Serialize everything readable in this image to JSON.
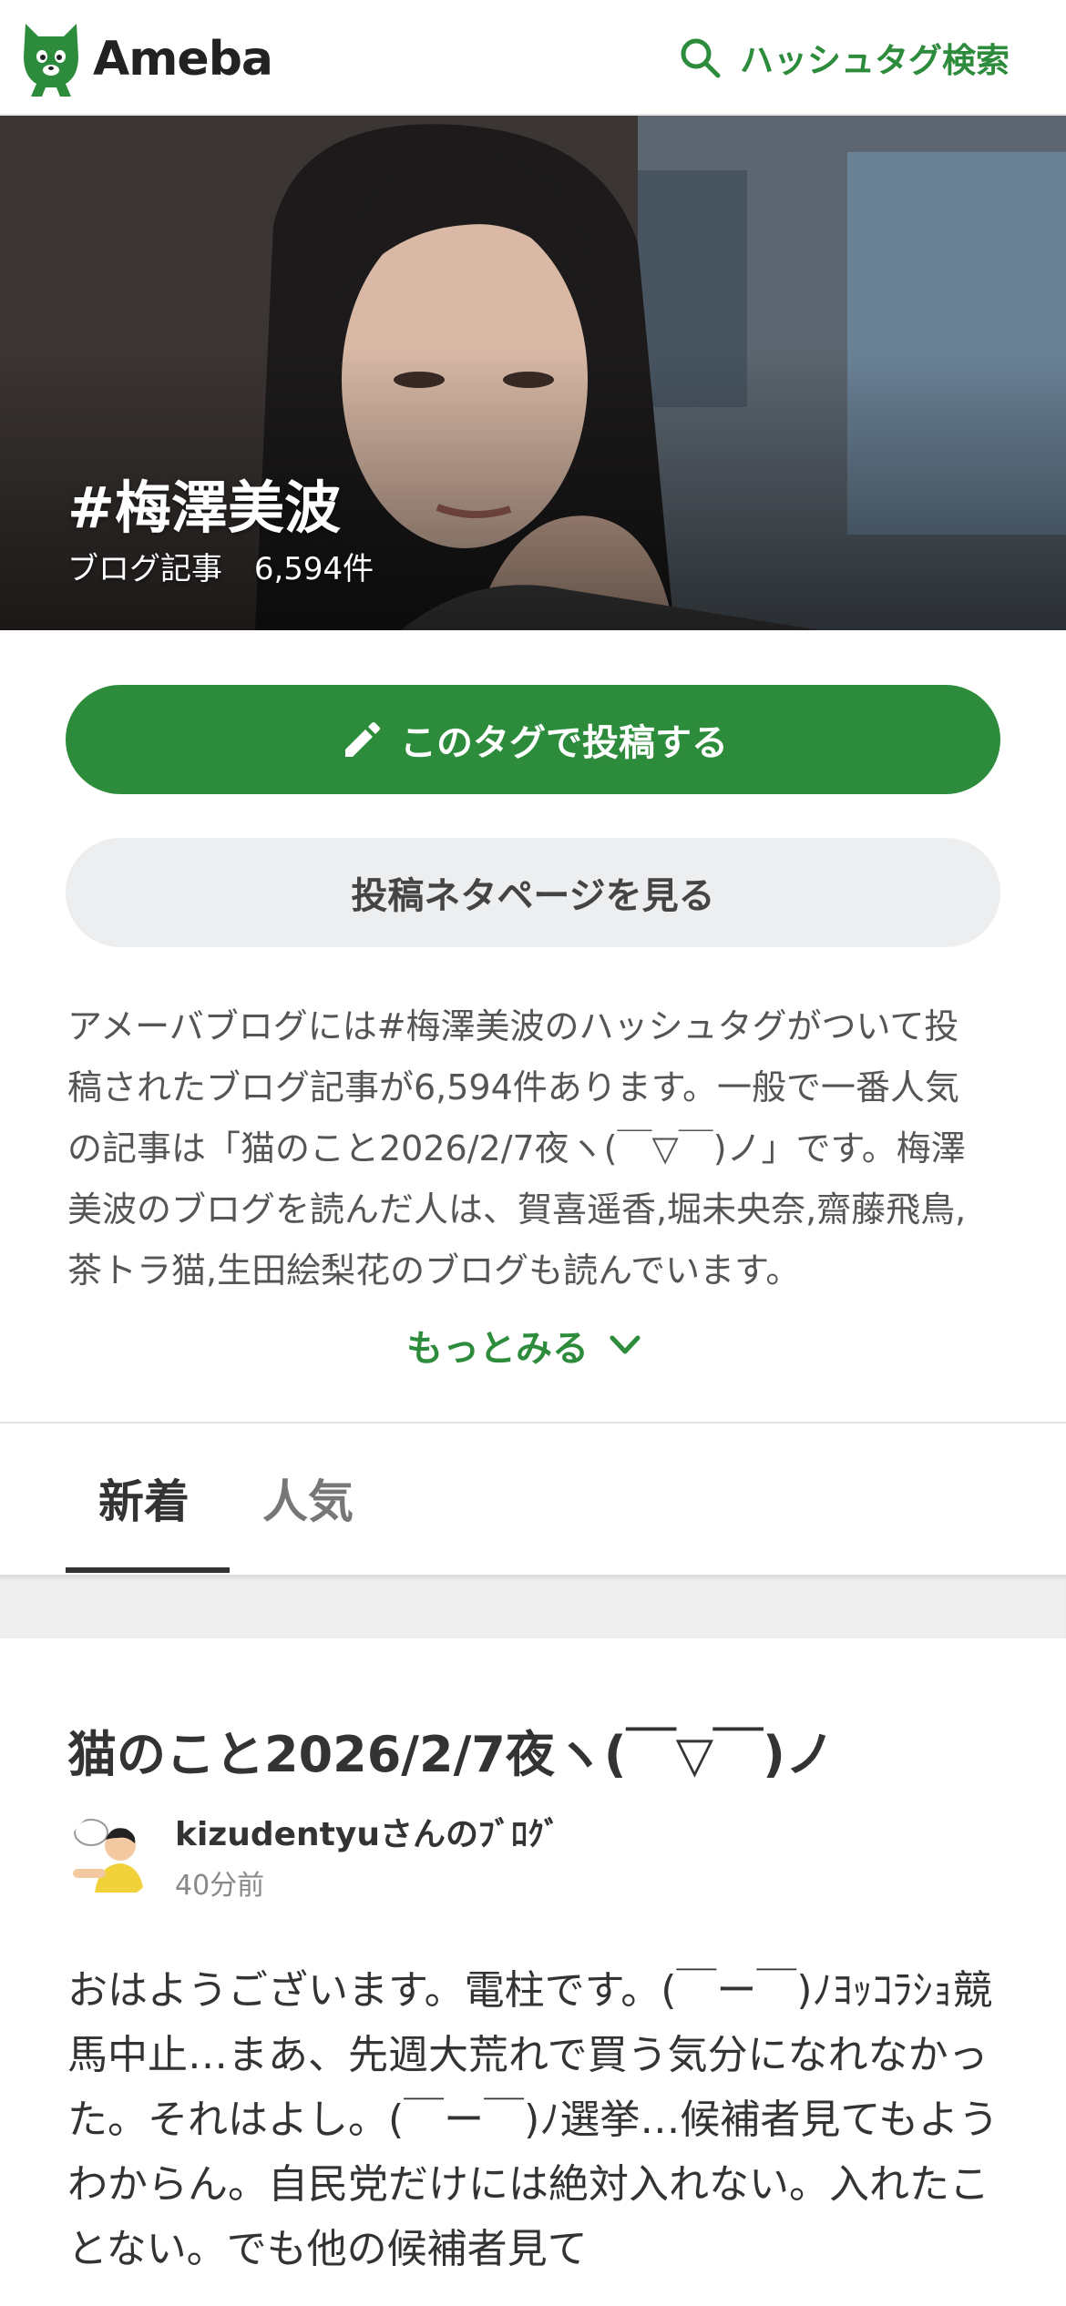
{
  "header": {
    "logo_text": "Ameba",
    "search_label": "ハッシュタグ検索"
  },
  "hero": {
    "title": "#梅澤美波",
    "count_label": "ブログ記事",
    "count_value": "6,594件"
  },
  "actions": {
    "post_label": "このタグで投稿する",
    "topics_label": "投稿ネタページを見る"
  },
  "description": {
    "text": "アメーバブログには#梅澤美波のハッシュタグがついて投稿されたブログ記事が6,594件あります。一般で一番人気の記事は「猫のこと2026/2/7夜ヽ(￣▽￣)ノ」です。梅澤美波のブログを読んだ人は、賀喜遥香,堀未央奈,齋藤飛鳥,茶トラ猫,生田絵梨花のブログも読んでいます。",
    "more_label": "もっとみる"
  },
  "tabs": [
    {
      "label": "新着",
      "active": true
    },
    {
      "label": "人気",
      "active": false
    }
  ],
  "article": {
    "title": "猫のこと2026/2/7夜ヽ(￣▽￣)ノ",
    "author": "kizudentyuさんのﾌﾞﾛｸﾞ",
    "time": "40分前",
    "excerpt": "おはようございます。電柱です。(￣ー￣)ﾉﾖｯｺﾗｼｮ競馬中止…まあ、先週大荒れで買う気分になれなかった。それはよし。(￣ー￣)ﾉ選挙…候補者見てもようわからん。自民党だけには絶対入れない。入れたことない。でも他の候補者見て"
  },
  "colors": {
    "brand_green": "#2d8c3c",
    "secondary_bg": "#eceef0"
  }
}
